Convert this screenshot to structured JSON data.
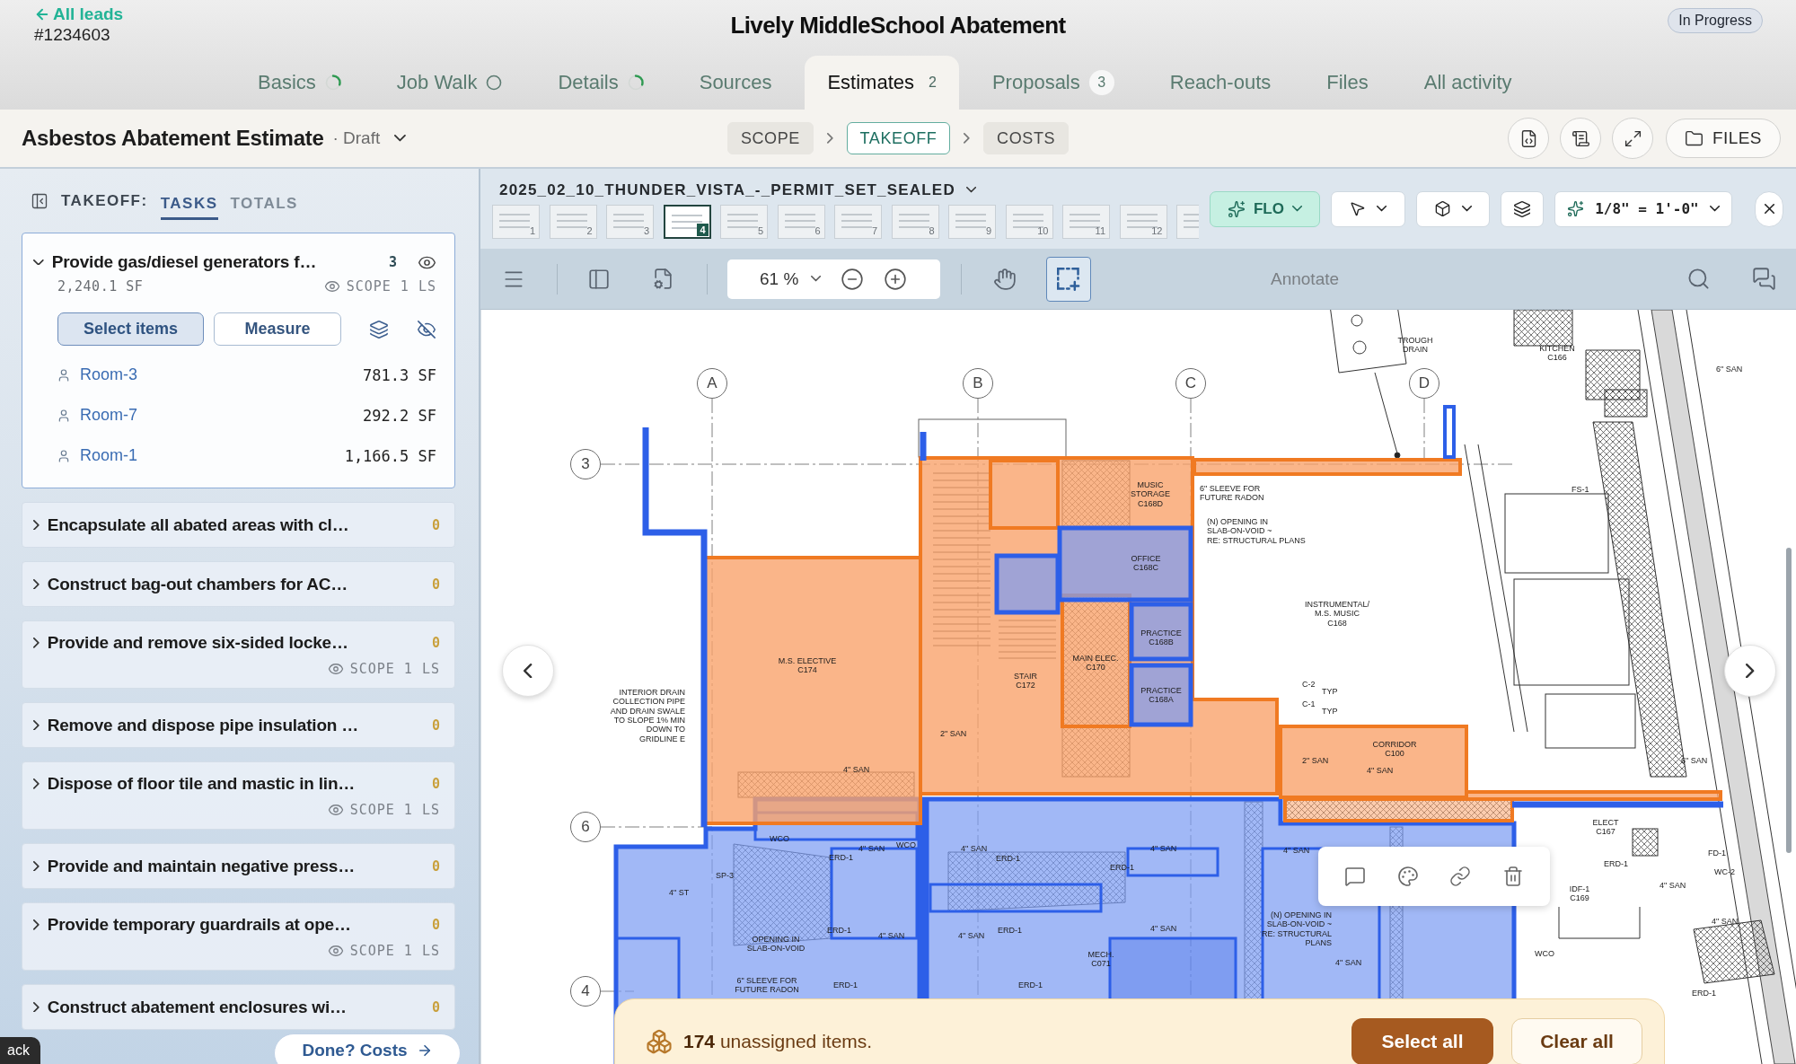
{
  "header": {
    "back_link": "All leads",
    "lead_number": "#1234603",
    "title": "Lively MiddleSchool Abatement",
    "status": "In Progress"
  },
  "tabs": [
    {
      "label": "Basics",
      "selected": false,
      "started": true
    },
    {
      "label": "Job Walk",
      "selected": false,
      "started": false
    },
    {
      "label": "Details",
      "selected": false,
      "started": true
    },
    {
      "label": "Sources",
      "selected": false
    },
    {
      "label": "Estimates",
      "selected": true,
      "count": "2"
    },
    {
      "label": "Proposals",
      "selected": false,
      "count": "3"
    },
    {
      "label": "Reach-outs",
      "selected": false
    },
    {
      "label": "Files",
      "selected": false
    },
    {
      "label": "All activity",
      "selected": false
    }
  ],
  "estimate_bar": {
    "title": "Asbestos Abatement Estimate",
    "status": "· Draft",
    "steps": [
      {
        "label": "SCOPE",
        "selected": false
      },
      {
        "label": "TAKEOFF",
        "selected": true
      },
      {
        "label": "COSTS",
        "selected": false
      }
    ],
    "files_button": "FILES"
  },
  "takeoff_panel": {
    "heading": "TAKEOFF:",
    "tabs": [
      {
        "label": "TASKS",
        "selected": true
      },
      {
        "label": "TOTALS",
        "selected": false
      }
    ],
    "tasks": [
      {
        "title": "Provide gas/diesel generators f…",
        "count": "3",
        "color": "#2e4b55",
        "expanded": true,
        "quantity": "2,240.1 SF",
        "scope": "SCOPE 1 LS",
        "actions": [
          {
            "label": "Select items",
            "selected": true
          },
          {
            "label": "Measure",
            "selected": false
          }
        ],
        "rooms": [
          {
            "name": "Room-3",
            "area": "781.3 SF"
          },
          {
            "name": "Room-7",
            "area": "292.2 SF"
          },
          {
            "name": "Room-1",
            "area": "1,166.5 SF"
          }
        ]
      },
      {
        "title": "Encapsulate all abated areas with cl…",
        "count": "0",
        "color": "#c9a03c",
        "expanded": false
      },
      {
        "title": "Construct bag-out chambers for AC…",
        "count": "0",
        "color": "#c9a03c",
        "expanded": false
      },
      {
        "title": "Provide and remove six-sided locke…",
        "count": "0",
        "color": "#c9a03c",
        "expanded": false,
        "scope": "SCOPE 1 LS"
      },
      {
        "title": "Remove and dispose pipe insulation …",
        "count": "0",
        "color": "#c9a03c",
        "expanded": false
      },
      {
        "title": "Dispose of floor tile and mastic in lin…",
        "count": "0",
        "color": "#c9a03c",
        "expanded": false,
        "scope": "SCOPE 1 LS"
      },
      {
        "title": "Provide and maintain negative press…",
        "count": "0",
        "color": "#c9a03c",
        "expanded": false
      },
      {
        "title": "Provide temporary guardrails at ope…",
        "count": "0",
        "color": "#c9a03c",
        "expanded": false,
        "scope": "SCOPE 1 LS"
      },
      {
        "title": "Construct abatement enclosures wi…",
        "count": "0",
        "color": "#c9a03c",
        "expanded": false
      }
    ],
    "done_button": "Done? Costs"
  },
  "feedback_tab": "ack",
  "viewer": {
    "file_name": "2025_02_10_THUNDER_VISTA_-_PERMIT_SET_SEALED",
    "pages": [
      {
        "number": "1",
        "selected": false
      },
      {
        "number": "2",
        "selected": false
      },
      {
        "number": "3",
        "selected": false
      },
      {
        "number": "4",
        "selected": true
      },
      {
        "number": "5",
        "selected": false
      },
      {
        "number": "6",
        "selected": false
      },
      {
        "number": "7",
        "selected": false
      },
      {
        "number": "8",
        "selected": false
      },
      {
        "number": "9",
        "selected": false
      },
      {
        "number": "10",
        "selected": false
      },
      {
        "number": "11",
        "selected": false
      },
      {
        "number": "12",
        "selected": false
      },
      {
        "selected": false
      }
    ],
    "ai_button": "FLO",
    "scale": "1/8\" = 1'-0\"",
    "zoom": "61 %",
    "tools": [
      {
        "kind": "pan",
        "selected": false
      },
      {
        "kind": "select",
        "selected": true
      }
    ],
    "mode_label": "Annotate",
    "plan": {
      "grid_marks": [
        "A",
        "B",
        "C",
        "D",
        "3",
        "6",
        "4"
      ],
      "labels": [
        "M.S. ELECTIVE\nC174",
        "STAIR\nC172",
        "MAIN ELEC.\nC170",
        "MUSIC\nSTORAGE\nC168D",
        "OFFICE\nC168C",
        "PRACTICE\nC168B",
        "PRACTICE\nC168A",
        "INSTRUMENTAL/\nM.S. MUSIC\nC168",
        "CORRIDOR\nC100",
        "6\" SLEEVE FOR\nFUTURE RADON",
        "(N) OPENING IN\nSLAB-ON-VOID ~\nRE: STRUCTURAL PLANS",
        "INTERIOR DRAIN\nCOLLECTION PIPE\nAND DRAIN SWALE\nTO SLOPE 1% MIN\nDOWN TO\nGRIDLINE E",
        "TROUGH\nDRAIN",
        "KITCHEN\nC166",
        "C-2",
        "TYP",
        "C-1",
        "TYP",
        "2\" SAN",
        "4\" SAN",
        "2\" SAN",
        "4\" SAN",
        "6\" SAN",
        "6\" SAN",
        "ELECT\nC167",
        "IDF-1\nC169",
        "4\" SAN",
        "4\" SAN",
        "WCO",
        "ERD-1",
        "MECH.\nC071",
        "(N) OPENING IN\nSLAB-ON-VOID ~\nRE: STRUCTURAL\nPLANS",
        "OPENING IN\nSLAB-ON-VOID",
        "6\" SLEEVE FOR\nFUTURE RADON",
        "4\" ST",
        "SP-3",
        "WCO",
        "WCO",
        "4\" SAN",
        "4\" SAN",
        "4\" SAN",
        "4\" SAN",
        "ERD-1",
        "ERD-1",
        "ERD-1",
        "4\" SAN",
        "4\" SAN",
        "ERD-1",
        "ERD-1",
        "4\" SAN",
        "4\" SAN",
        "ERD-1",
        "ERD-1",
        "FS-1",
        "FD-1",
        "WC-2",
        "ERD-1"
      ]
    },
    "banner": {
      "message": "**174** unassigned items.",
      "select_all": "Select all",
      "clear_all": "Clear all"
    }
  }
}
